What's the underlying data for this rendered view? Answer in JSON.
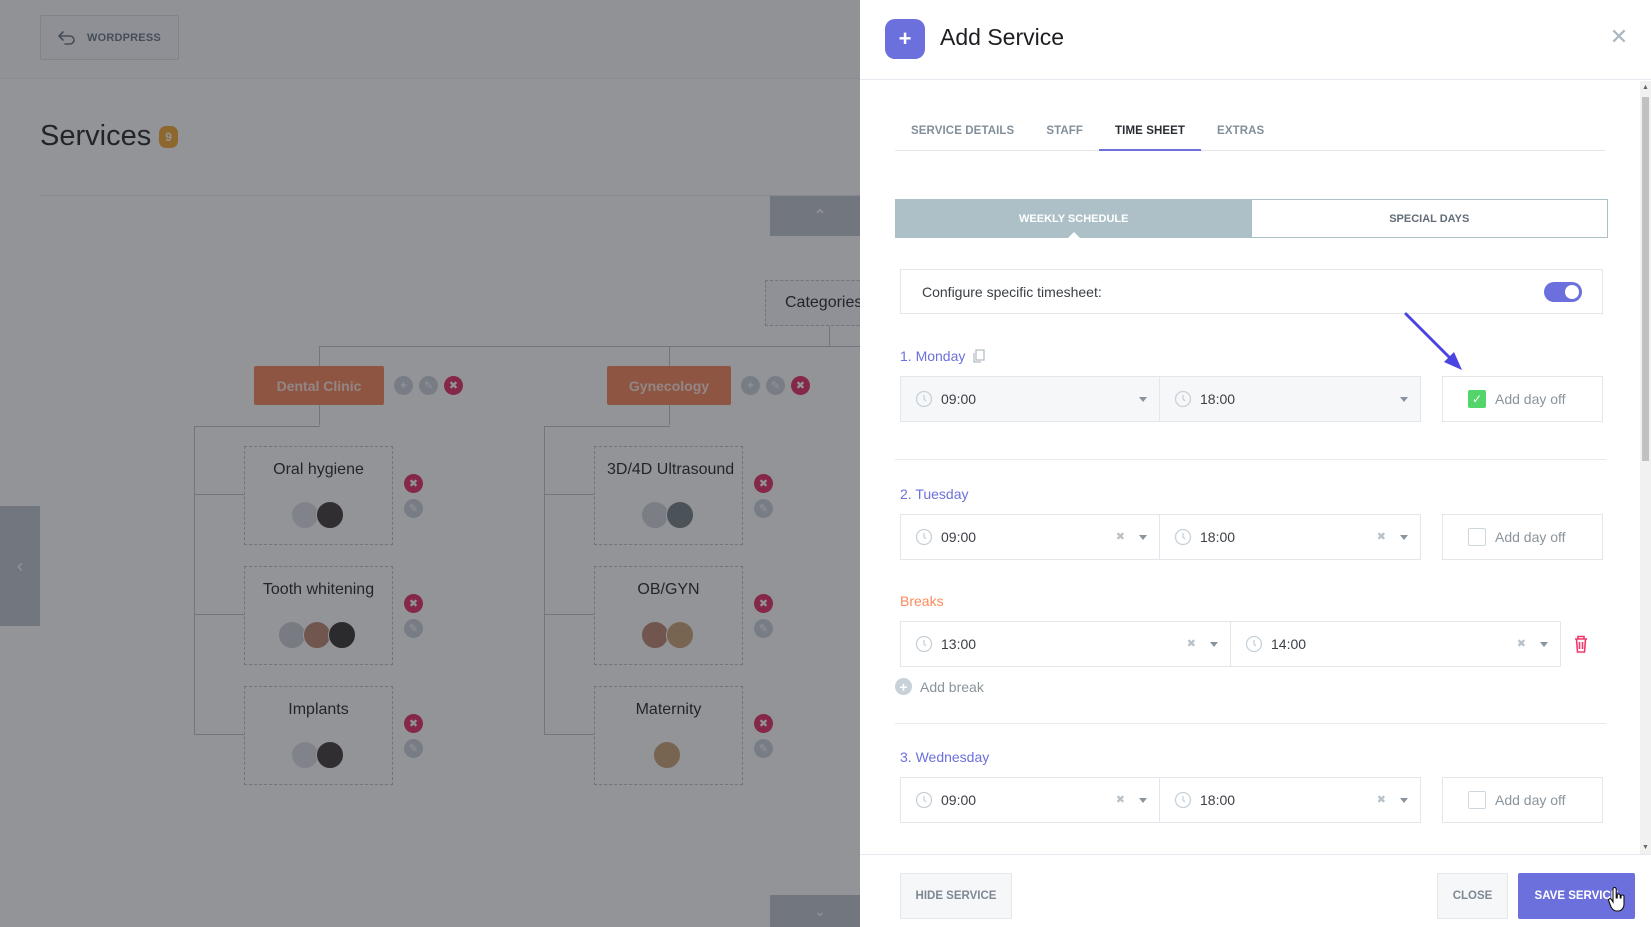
{
  "background": {
    "wordpress_button": "WORDPRESS",
    "page_title": "Services",
    "services_count": "9",
    "root_label": "Categories",
    "categories": [
      {
        "name": "Dental Clinic",
        "services": [
          {
            "name": "Oral hygiene",
            "staff_count": 2
          },
          {
            "name": "Tooth whitening",
            "staff_count": 3
          },
          {
            "name": "Implants",
            "staff_count": 2
          }
        ]
      },
      {
        "name": "Gynecology",
        "services": [
          {
            "name": "3D/4D Ultrasound",
            "staff_count": 2
          },
          {
            "name": "OB/GYN",
            "staff_count": 2
          },
          {
            "name": "Maternity",
            "staff_count": 1
          }
        ]
      }
    ]
  },
  "panel": {
    "title": "Add Service",
    "header_icon": "plus-icon",
    "close_icon": "close-icon",
    "tabs": [
      {
        "label": "SERVICE DETAILS",
        "active": false
      },
      {
        "label": "STAFF",
        "active": false
      },
      {
        "label": "TIME SHEET",
        "active": true
      },
      {
        "label": "EXTRAS",
        "active": false
      }
    ],
    "schedule_toggle": {
      "options": [
        "WEEKLY SCHEDULE",
        "SPECIAL DAYS"
      ],
      "selected": "WEEKLY SCHEDULE"
    },
    "configure_timesheet": {
      "label": "Configure specific timesheet:",
      "enabled": true
    },
    "days": [
      {
        "label": "1. Monday",
        "start": "09:00",
        "end": "18:00",
        "day_off": true,
        "day_off_label": "Add day off",
        "copy_icon": "copy-icon"
      },
      {
        "label": "2. Tuesday",
        "start": "09:00",
        "end": "18:00",
        "day_off": false,
        "day_off_label": "Add day off",
        "breaks_label": "Breaks",
        "breaks": [
          {
            "start": "13:00",
            "end": "14:00"
          }
        ],
        "add_break_label": "Add break"
      },
      {
        "label": "3. Wednesday",
        "start": "09:00",
        "end": "18:00",
        "day_off": false,
        "day_off_label": "Add day off"
      }
    ],
    "footer": {
      "hide_service": "HIDE SERVICE",
      "close": "CLOSE",
      "save_service": "SAVE SERVICE"
    }
  },
  "colors": {
    "accent": "#6c70dc",
    "category": "#f78154",
    "danger": "#e0245e",
    "breaks": "#fb8a5a",
    "checked": "#53d56c",
    "badge": "#f3a42b"
  }
}
